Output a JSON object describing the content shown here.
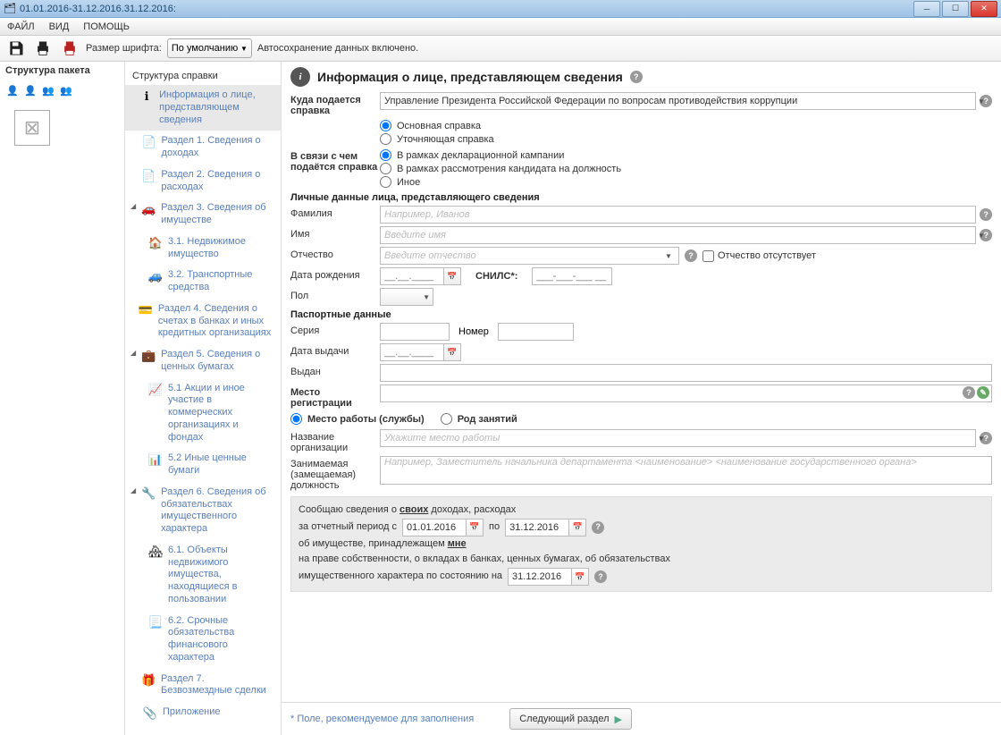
{
  "window": {
    "title": "01.01.2016-31.12.2016.31.12.2016:"
  },
  "menubar": {
    "file": "ФАЙЛ",
    "view": "ВИД",
    "help": "ПОМОЩЬ"
  },
  "toolbar": {
    "font_label": "Размер шрифта:",
    "font_value": "По умолчанию",
    "autosave": "Автосохранение данных включено."
  },
  "left_panel": {
    "header": "Структура пакета"
  },
  "nav": {
    "header": "Структура справки",
    "items": [
      {
        "icon": "ℹ",
        "label": "Информация о лице, представляющем сведения",
        "selected": true
      },
      {
        "icon": "📄",
        "label": "Раздел 1. Сведения о доходах"
      },
      {
        "icon": "📄",
        "label": "Раздел 2. Сведения о расходах"
      },
      {
        "icon": "🚗",
        "label": "Раздел 3. Сведения об имуществе",
        "expand": true,
        "children": [
          {
            "icon": "🏠",
            "label": "3.1. Недвижимое имущество"
          },
          {
            "icon": "🚙",
            "label": "3.2. Транспортные средства"
          }
        ]
      },
      {
        "icon": "💳",
        "label": "Раздел 4. Сведения о счетах в банках и иных кредитных организациях"
      },
      {
        "icon": "💼",
        "label": "Раздел 5. Сведения о ценных бумагах",
        "expand": true,
        "children": [
          {
            "icon": "📈",
            "label": "5.1 Акции и иное участие в коммерческих организациях и фондах"
          },
          {
            "icon": "📊",
            "label": "5.2 Иные ценные бумаги"
          }
        ]
      },
      {
        "icon": "🔧",
        "label": "Раздел 6. Сведения об обязательствах имущественного характера",
        "expand": true,
        "children": [
          {
            "icon": "🏘",
            "label": "6.1. Объекты недвижимого имущества, находящиеся в пользовании"
          },
          {
            "icon": "📃",
            "label": "6.2. Срочные обязательства финансового характера"
          }
        ]
      },
      {
        "icon": "🎁",
        "label": "Раздел 7. Безвозмездные сделки"
      },
      {
        "icon": "📎",
        "label": "Приложение"
      }
    ]
  },
  "form": {
    "page_title": "Информация о лице, представляющем сведения",
    "submit_to_label": "Куда подается справка",
    "submit_to_value": "Управление Президента Российской Федерации по вопросам противодействия коррупции",
    "radios1": {
      "main": "Основная справка",
      "clarify": "Уточняющая справка"
    },
    "reason_label": "В связи с чем подаётся справка",
    "radios2": {
      "campaign": "В рамках декларационной кампании",
      "candidate": "В рамках рассмотрения кандидата на должность",
      "other": "Иное"
    },
    "personal_header": "Личные данные лица, представляющего сведения",
    "surname_label": "Фамилия",
    "surname_ph": "Например, Иванов",
    "name_label": "Имя",
    "name_ph": "Введите имя",
    "patr_label": "Отчество",
    "patr_ph": "Введите отчество",
    "no_patr": "Отчество отсутствует",
    "dob_label": "Дата рождения",
    "date_blank": "__.__.____",
    "snils_label": "СНИЛС*:",
    "snils_blank": "___-___-___ __",
    "gender_label": "Пол",
    "passport_header": "Паспортные данные",
    "series_label": "Серия",
    "number_label": "Номер",
    "issue_date_label": "Дата выдачи",
    "issued_by_label": "Выдан",
    "reg_header": "Место регистрации",
    "work_radio": "Место работы (службы)",
    "occupation_radio": "Род занятий",
    "org_label": "Название организации",
    "org_ph": "Укажите место работы",
    "position_label": "Занимаемая (замещаемая) должность",
    "position_ph": "Например, Заместитель начальника департамента <наименование> <наименование государственного органа>",
    "decl_text1": "Сообщаю сведения о ",
    "decl_own": "своих",
    "decl_text2": " доходах, расходах",
    "period_label": "за отчетный период с",
    "period_from": "01.01.2016",
    "period_to_label": "по",
    "period_to": "31.12.2016",
    "decl_text3": "об имуществе, принадлежащем ",
    "decl_me": "мне",
    "decl_text4": "на праве собственности, о вкладах в банках, ценных бумагах, об обязательствах",
    "decl_text5": "имущественного характера по состоянию на",
    "as_of_date": "31.12.2016"
  },
  "footer": {
    "hint": "Поле, рекомендуемое для заполнения",
    "next": "Следующий раздел"
  }
}
